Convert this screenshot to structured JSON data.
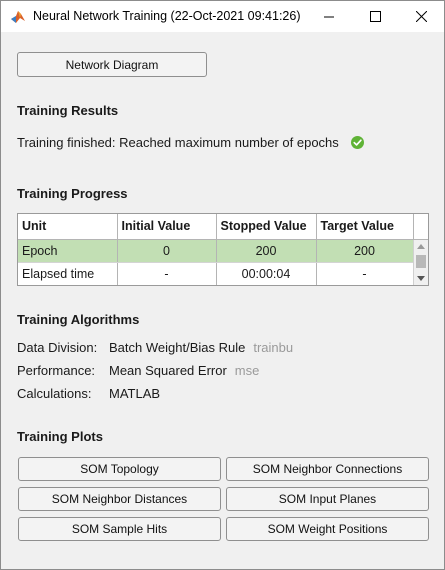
{
  "window": {
    "title": "Neural Network Training (22-Oct-2021 09:41:26)"
  },
  "toolbar": {
    "network_diagram_label": "Network Diagram"
  },
  "results": {
    "heading": "Training Results",
    "status": "Training finished: Reached maximum number of epochs",
    "status_icon": "check-circle-icon",
    "status_color": "#5fb336"
  },
  "progress": {
    "heading": "Training Progress",
    "columns": [
      "Unit",
      "Initial Value",
      "Stopped Value",
      "Target Value"
    ],
    "rows": [
      {
        "unit": "Epoch",
        "initial": "0",
        "stopped": "200",
        "target": "200"
      },
      {
        "unit": "Elapsed time",
        "initial": "-",
        "stopped": "00:00:04",
        "target": "-"
      }
    ],
    "highlight_color": "#c2dfb4"
  },
  "algorithms": {
    "heading": "Training Algorithms",
    "items": [
      {
        "label": "Data Division:",
        "value": "Batch Weight/Bias Rule",
        "fn": "trainbu"
      },
      {
        "label": "Performance:",
        "value": "Mean Squared Error",
        "fn": "mse"
      },
      {
        "label": "Calculations:",
        "value": "MATLAB",
        "fn": ""
      }
    ]
  },
  "plots": {
    "heading": "Training Plots",
    "buttons": [
      "SOM Topology",
      "SOM Neighbor Connections",
      "SOM Neighbor Distances",
      "SOM Input Planes",
      "SOM Sample Hits",
      "SOM Weight Positions"
    ]
  }
}
